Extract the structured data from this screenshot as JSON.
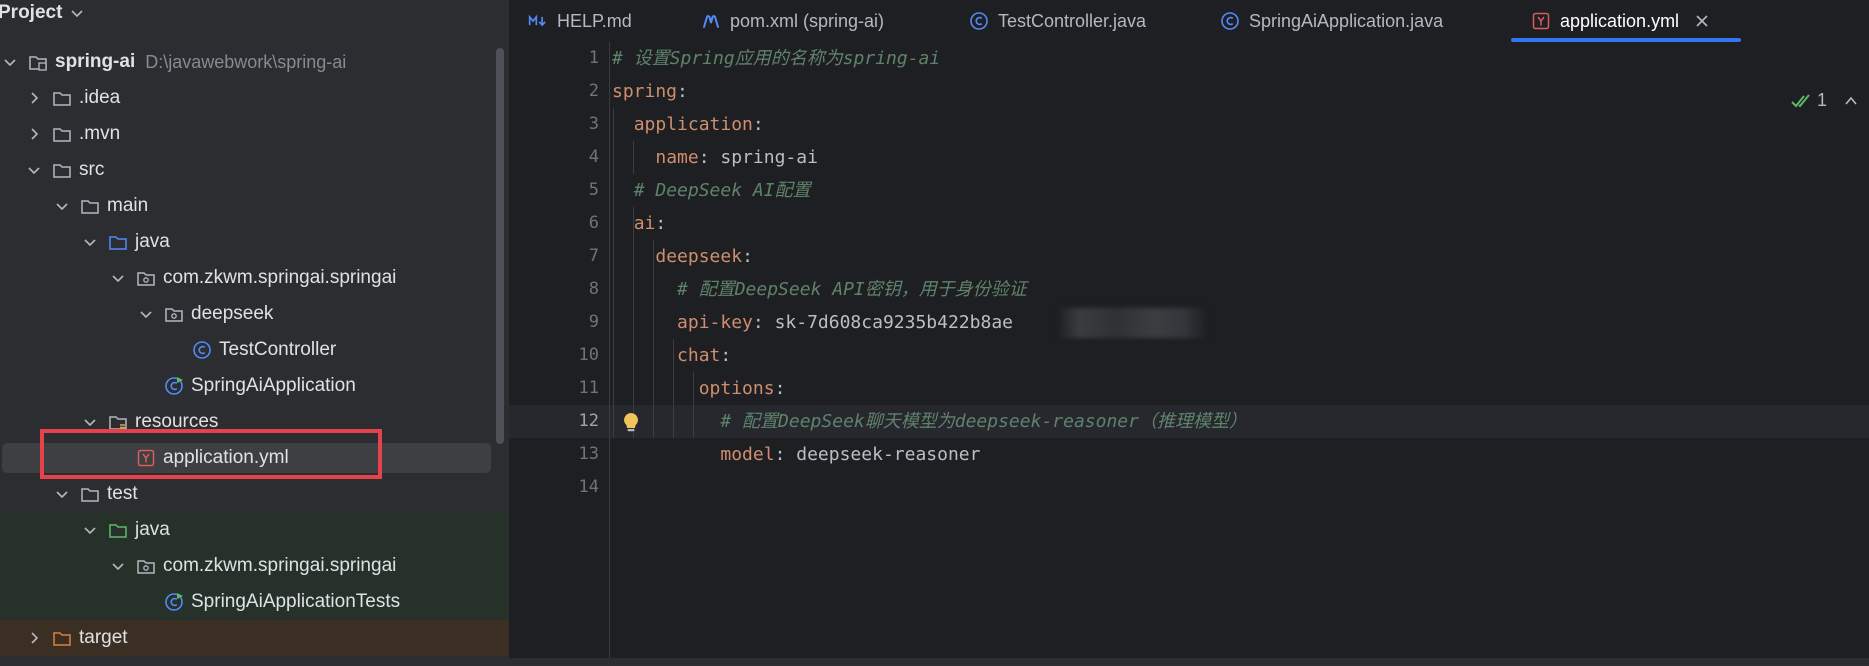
{
  "project_panel": {
    "title": "Project",
    "tree": [
      {
        "label": "spring-ai",
        "path": "D:\\javawebwork\\spring-ai"
      },
      {
        "label": ".idea"
      },
      {
        "label": ".mvn"
      },
      {
        "label": "src"
      },
      {
        "label": "main"
      },
      {
        "label": "java"
      },
      {
        "label": "com.zkwm.springai.springai"
      },
      {
        "label": "deepseek"
      },
      {
        "label": "TestController"
      },
      {
        "label": "SpringAiApplication"
      },
      {
        "label": "resources"
      },
      {
        "label": "application.yml"
      },
      {
        "label": "test"
      },
      {
        "label": "java"
      },
      {
        "label": "com.zkwm.springai.springai"
      },
      {
        "label": "SpringAiApplicationTests"
      },
      {
        "label": "target"
      }
    ]
  },
  "tabs": [
    {
      "label": "HELP.md",
      "icon": "markdown-icon"
    },
    {
      "label": "pom.xml (spring-ai)",
      "icon": "maven-icon"
    },
    {
      "label": "TestController.java",
      "icon": "class-icon"
    },
    {
      "label": "SpringAiApplication.java",
      "icon": "class-icon"
    },
    {
      "label": "application.yml",
      "icon": "yaml-icon",
      "active": true
    }
  ],
  "editor": {
    "inspection_count": "1",
    "current_line": 12,
    "lines": [
      {
        "n": "1",
        "parts": [
          {
            "t": "# 设置Spring应用的名称为spring-ai",
            "c": "comment"
          }
        ]
      },
      {
        "n": "2",
        "parts": [
          {
            "t": "spring",
            "c": "key"
          },
          {
            "t": ":",
            "c": "punct"
          }
        ]
      },
      {
        "n": "3",
        "parts": [
          {
            "t": "  "
          },
          {
            "t": "application",
            "c": "key"
          },
          {
            "t": ":",
            "c": "punct"
          }
        ]
      },
      {
        "n": "4",
        "parts": [
          {
            "t": "    "
          },
          {
            "t": "name",
            "c": "key"
          },
          {
            "t": ": ",
            "c": "punct"
          },
          {
            "t": "spring-ai",
            "c": "value"
          }
        ]
      },
      {
        "n": "5",
        "parts": [
          {
            "t": "  "
          },
          {
            "t": "# DeepSeek AI配置",
            "c": "comment"
          }
        ]
      },
      {
        "n": "6",
        "parts": [
          {
            "t": "  "
          },
          {
            "t": "ai",
            "c": "key"
          },
          {
            "t": ":",
            "c": "punct"
          }
        ]
      },
      {
        "n": "7",
        "parts": [
          {
            "t": "    "
          },
          {
            "t": "deepseek",
            "c": "key"
          },
          {
            "t": ":",
            "c": "punct"
          }
        ]
      },
      {
        "n": "8",
        "parts": [
          {
            "t": "      "
          },
          {
            "t": "# 配置DeepSeek API密钥，用于身份验证",
            "c": "comment"
          }
        ]
      },
      {
        "n": "9",
        "parts": [
          {
            "t": "      "
          },
          {
            "t": "api-key",
            "c": "key"
          },
          {
            "t": ": ",
            "c": "punct"
          },
          {
            "t": "sk-7d608ca9235b422b8ae",
            "c": "value"
          }
        ]
      },
      {
        "n": "10",
        "parts": [
          {
            "t": "      "
          },
          {
            "t": "chat",
            "c": "key"
          },
          {
            "t": ":",
            "c": "punct"
          }
        ]
      },
      {
        "n": "11",
        "parts": [
          {
            "t": "        "
          },
          {
            "t": "options",
            "c": "key"
          },
          {
            "t": ":",
            "c": "punct"
          }
        ]
      },
      {
        "n": "12",
        "parts": [
          {
            "t": "          "
          },
          {
            "t": "# 配置DeepSeek聊天模型为deepseek-reasoner（推理模型）",
            "c": "comment"
          }
        ]
      },
      {
        "n": "13",
        "parts": [
          {
            "t": "          "
          },
          {
            "t": "model",
            "c": "key"
          },
          {
            "t": ": ",
            "c": "punct"
          },
          {
            "t": "deepseek-reasoner",
            "c": "value"
          }
        ]
      },
      {
        "n": "14",
        "parts": []
      }
    ]
  },
  "colors": {
    "accent": "#3574f0",
    "highlight_box": "#e5424b",
    "yaml_key": "#cf8e6d",
    "comment": "#5f826b"
  }
}
